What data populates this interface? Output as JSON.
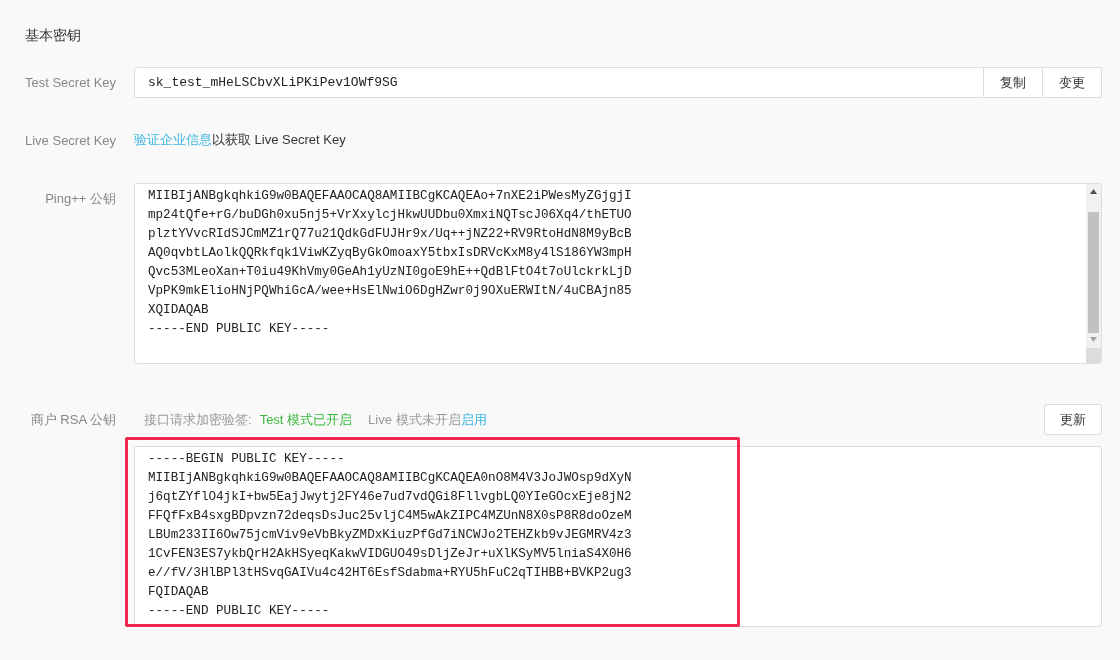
{
  "section_title": "基本密钥",
  "test_secret_key": {
    "label": "Test Secret Key",
    "value": "sk_test_mHeLSCbvXLiPKiPev1OWf9SG",
    "buttons": [
      "复制",
      "变更"
    ]
  },
  "live_secret_key": {
    "label": "Live Secret Key",
    "link": "验证企业信息",
    "text": "以获取 Live Secret Key"
  },
  "ping_public_key": {
    "label": "Ping++ 公钥",
    "lines": [
      "MIIBIjANBgkqhkiG9w0BAQEFAAOCAQ8AMIIBCgKCAQEAo+7nXE2iPWesMyZGjgjI",
      "mp24tQfe+rG/buDGh0xu5nj5+VrXxylcjHkwUUDbu0XmxiNQTscJ06Xq4/thETUO",
      "plztYVvcRIdSJCmMZ1rQ77u21QdkGdFUJHr9x/Uq++jNZ22+RV9RtoHdN8M9yBcB",
      "AQ0qvbtLAolkQQRkfqk1ViwKZyqByGkOmoaxY5tbxIsDRVcKxM8y4lS186YW3mpH",
      "Qvc53MLeoXan+T0iu49KhVmy0GeAh1yUzNI0goE9hE++QdBlFtO4t7oUlckrkLjD",
      "VpPK9mkElioHNjPQWhiGcA/wee+HsElNwiO6DgHZwr0j9OXuERWItN/4uCBAjn85",
      "XQIDAQAB",
      "-----END PUBLIC KEY-----"
    ]
  },
  "merchant_rsa_public_key": {
    "label": "商户 RSA 公钥",
    "signing_label": "接口请求加密验签:",
    "test_mode_status": "Test 模式已开启",
    "live_mode_status": "Live 模式未开启",
    "enable_link": "启用",
    "update_button": "更新",
    "highlighted": true,
    "lines": [
      "-----BEGIN PUBLIC KEY-----",
      "MIIBIjANBgkqhkiG9w0BAQEFAAOCAQ8AMIIBCgKCAQEA0nO8M4V3JoJWOsp9dXyN",
      "j6qtZYflO4jkI+bw5EajJwytj2FY46e7ud7vdQGi8FllvgbLQ0YIeGOcxEje8jN2",
      "FFQfFxB4sxgBDpvzn72deqsDsJuc25vljC4M5wAkZIPC4MZUnN8X0sP8R8doOzeM",
      "LBUm233II6Ow75jcmViv9eVbBkyZMDxKiuzPfGd7iNCWJo2TEHZkb9vJEGMRV4z3",
      "1CvFEN3ES7ykbQrH2AkHSyeqKakwVIDGUO49sDljZeJr+uXlKSyMV5lniaS4X0H6",
      "e//fV/3HlBPl3tHSvqGAIVu4c42HT6EsfSdabma+RYU5hFuC2qTIHBB+BVKP2ug3",
      "FQIDAQAB",
      "-----END PUBLIC KEY-----"
    ]
  }
}
